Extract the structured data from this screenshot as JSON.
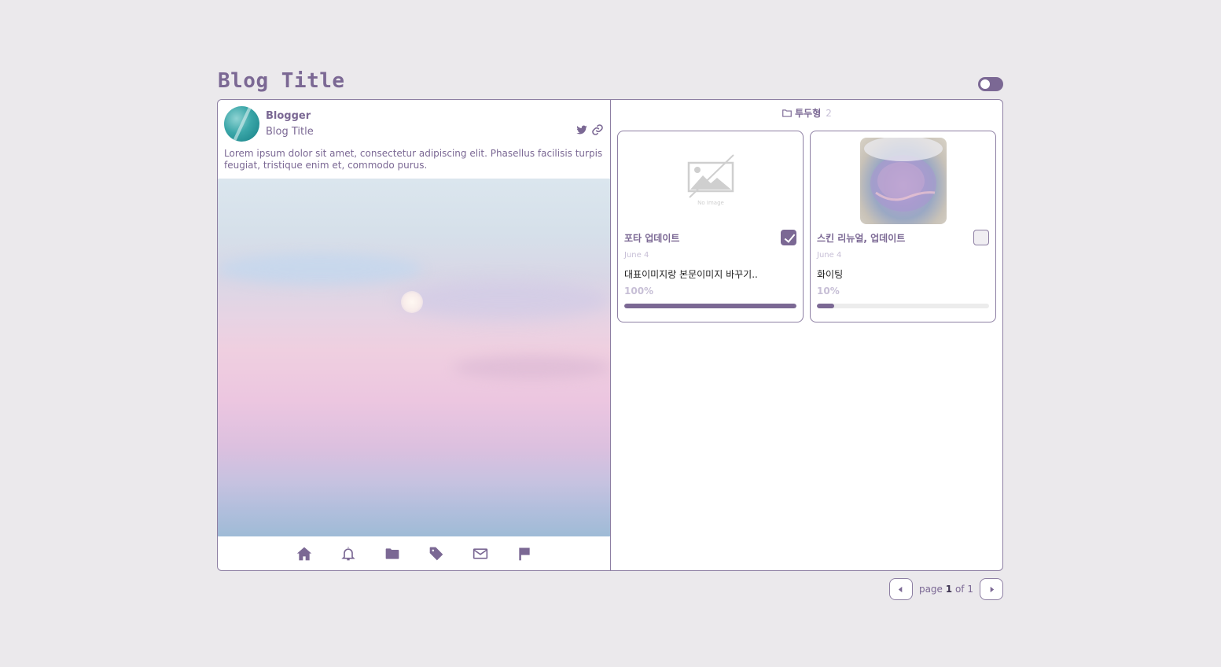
{
  "header": {
    "title": "Blog Title"
  },
  "profile": {
    "name": "Blogger",
    "subtitle": "Blog Title",
    "description": "Lorem ipsum dolor sit amet, consectetur adipiscing elit. Phasellus facilisis turpis feugiat, tristique enim et, commodo purus.",
    "social_icons": [
      "twitter-icon",
      "link-icon"
    ]
  },
  "bottom_nav": [
    "home-icon",
    "bell-icon",
    "folder-icon",
    "tag-icon",
    "mail-icon",
    "flag-icon"
  ],
  "folder": {
    "name": "투두형",
    "count": "2"
  },
  "cards": [
    {
      "title": "포타 업데이트",
      "date": "June 4",
      "text": "대표이미지랑 본문이미지 바꾸기..",
      "percent_label": "100%",
      "progress": 100,
      "checked": true,
      "no_image_label": "No Image"
    },
    {
      "title": "스킨 리뉴얼, 업데이트",
      "date": "June 4",
      "text": "화이팅",
      "percent_label": "10%",
      "progress": 10,
      "checked": false
    }
  ],
  "pager": {
    "prefix": "page",
    "current": "1",
    "of": "of",
    "total": "1"
  },
  "colors": {
    "accent": "#7b6894",
    "muted": "#c7bfd6",
    "background": "#ebe9ec"
  }
}
